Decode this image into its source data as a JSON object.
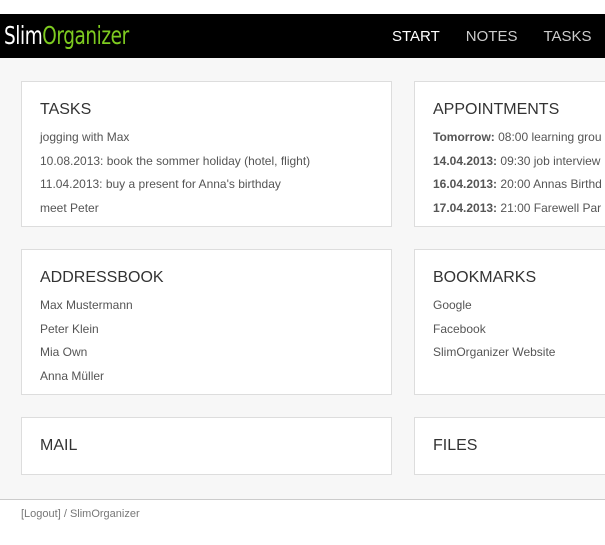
{
  "app": {
    "logo_part1": "Slim",
    "logo_part2": "Organizer"
  },
  "nav": [
    {
      "label": "START"
    },
    {
      "label": "NOTES"
    },
    {
      "label": "TASKS"
    }
  ],
  "tasks": {
    "title": "TASKS",
    "items": [
      "jogging with Max",
      "10.08.2013: book the sommer holiday (hotel, flight)",
      "11.04.2013: buy a present for Anna's birthday",
      "meet Peter"
    ]
  },
  "appointments": {
    "title": "APPOINTMENTS",
    "items": [
      {
        "date": "Tomorrow:",
        "text": " 08:00 learning grou"
      },
      {
        "date": "14.04.2013:",
        "text": " 09:30 job interview"
      },
      {
        "date": "16.04.2013:",
        "text": " 20:00 Annas Birthd"
      },
      {
        "date": "17.04.2013:",
        "text": " 21:00 Farewell Par"
      }
    ]
  },
  "addressbook": {
    "title": "ADDRESSBOOK",
    "items": [
      "Max Mustermann",
      "Peter Klein",
      "Mia Own",
      "Anna Müller"
    ]
  },
  "bookmarks": {
    "title": "BOOKMARKS",
    "items": [
      "Google",
      "Facebook",
      "SlimOrganizer Website"
    ]
  },
  "mail": {
    "title": "MAIL"
  },
  "files": {
    "title": "FILES"
  },
  "footer": {
    "logout": "[Logout]",
    "sep": " / ",
    "app": "SlimOrganizer"
  }
}
